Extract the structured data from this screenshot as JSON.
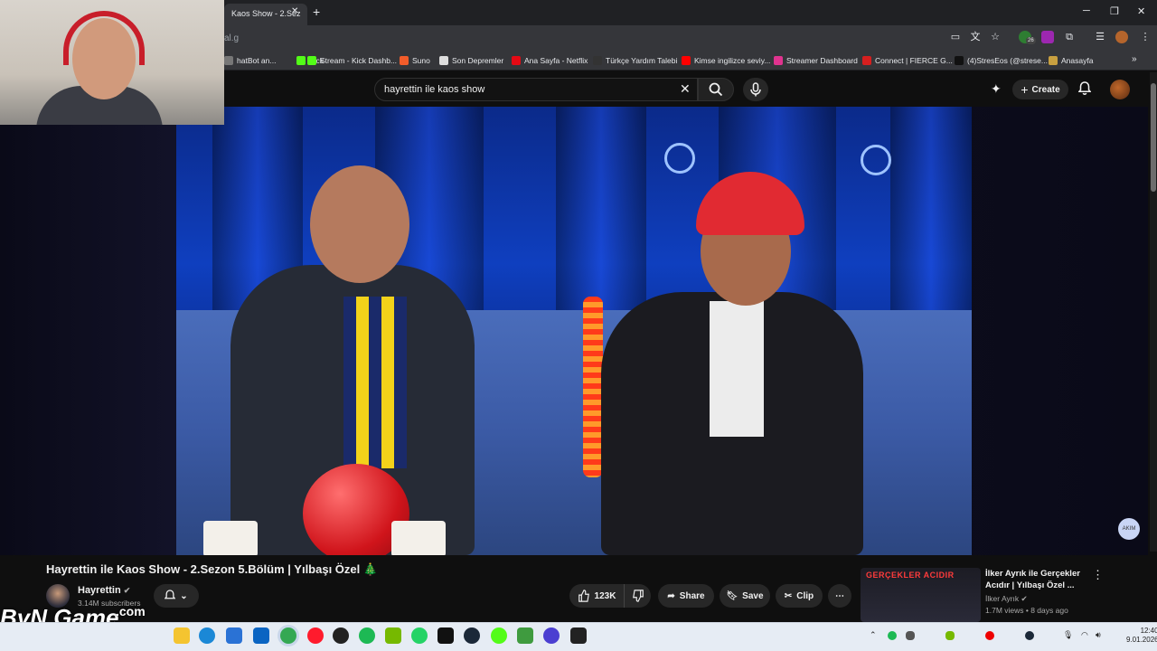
{
  "browser": {
    "tab_title": "Kaos Show - 2.Sez",
    "url_fragment": "al.g",
    "extension_badge": "26",
    "bookmarks": [
      {
        "label": "hatBot an...",
        "color": "#777777"
      },
      {
        "label": "Kick",
        "color": "#53fc18"
      },
      {
        "label": "Stream - Kick Dashb...",
        "color": "#53fc18"
      },
      {
        "label": "Suno",
        "color": "#f25c2a"
      },
      {
        "label": "Son Depremler",
        "color": "#dddddd"
      },
      {
        "label": "Ana Sayfa - Netflix",
        "color": "#e50914"
      },
      {
        "label": "Türkçe Yardım Talebi",
        "color": "#333333"
      },
      {
        "label": "Kimse ingilizce seviy...",
        "color": "#ff0000"
      },
      {
        "label": "Streamer Dashboard",
        "color": "#e0338f"
      },
      {
        "label": "Connect | FIERCE G...",
        "color": "#d61f1f"
      },
      {
        "label": "(4)StresEos (@strese...",
        "color": "#111111"
      },
      {
        "label": "Anasayfa",
        "color": "#c8a040"
      }
    ]
  },
  "youtube": {
    "search_value": "hayrettin ile kaos show",
    "create_label": "Create",
    "video": {
      "title": "Hayrettin ile Kaos Show - 2.Sezon 5.Bölüm | Yılbaşı Özel 🎄",
      "channel": "Hayrettin",
      "subscribers": "3.14M subscribers",
      "likes": "123K",
      "share_label": "Share",
      "save_label": "Save",
      "clip_label": "Clip",
      "watermark": "AKIM"
    },
    "recommendation": {
      "thumb_text": "GERÇEKLER ACIDIR",
      "title": "İlker Ayrık ile Gerçekler Acıdır | Yılbaşı Özel ...",
      "channel": "İlker Ayrık",
      "meta": "1.7M views • 8 days ago"
    }
  },
  "overlay": {
    "logo_text": "ByN Game",
    "logo_suffix": ".com"
  },
  "taskbar": {
    "time": "12:40",
    "date": "9.01.2026"
  }
}
